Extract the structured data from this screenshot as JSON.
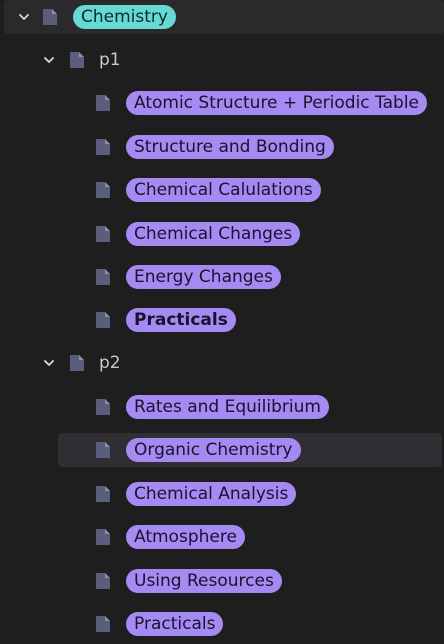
{
  "tree": {
    "root": {
      "label": "Chemistry",
      "expanded": true
    },
    "groups": [
      {
        "label": "p1",
        "expanded": true,
        "items": [
          {
            "label": "Atomic Structure + Periodic Table",
            "bold": false
          },
          {
            "label": "Structure and Bonding",
            "bold": false
          },
          {
            "label": "Chemical Calulations",
            "bold": false
          },
          {
            "label": "Chemical Changes",
            "bold": false
          },
          {
            "label": "Energy Changes",
            "bold": false
          },
          {
            "label": "Practicals",
            "bold": true
          }
        ]
      },
      {
        "label": "p2",
        "expanded": true,
        "items": [
          {
            "label": "Rates and Equilibrium",
            "bold": false
          },
          {
            "label": "Organic Chemistry",
            "bold": false,
            "selected": true
          },
          {
            "label": "Chemical Analysis",
            "bold": false
          },
          {
            "label": "Atmosphere",
            "bold": false
          },
          {
            "label": "Using Resources",
            "bold": false
          },
          {
            "label": "Practicals",
            "bold": false
          }
        ]
      }
    ]
  },
  "colors": {
    "background": "#1e1e1e",
    "root_tag": "#66d9d3",
    "item_tag": "#a58af2",
    "group_text": "#c8c8d0",
    "icon": "#5a5e7a"
  },
  "icons": {
    "expand": "chevron-down-icon",
    "page": "document-icon"
  }
}
